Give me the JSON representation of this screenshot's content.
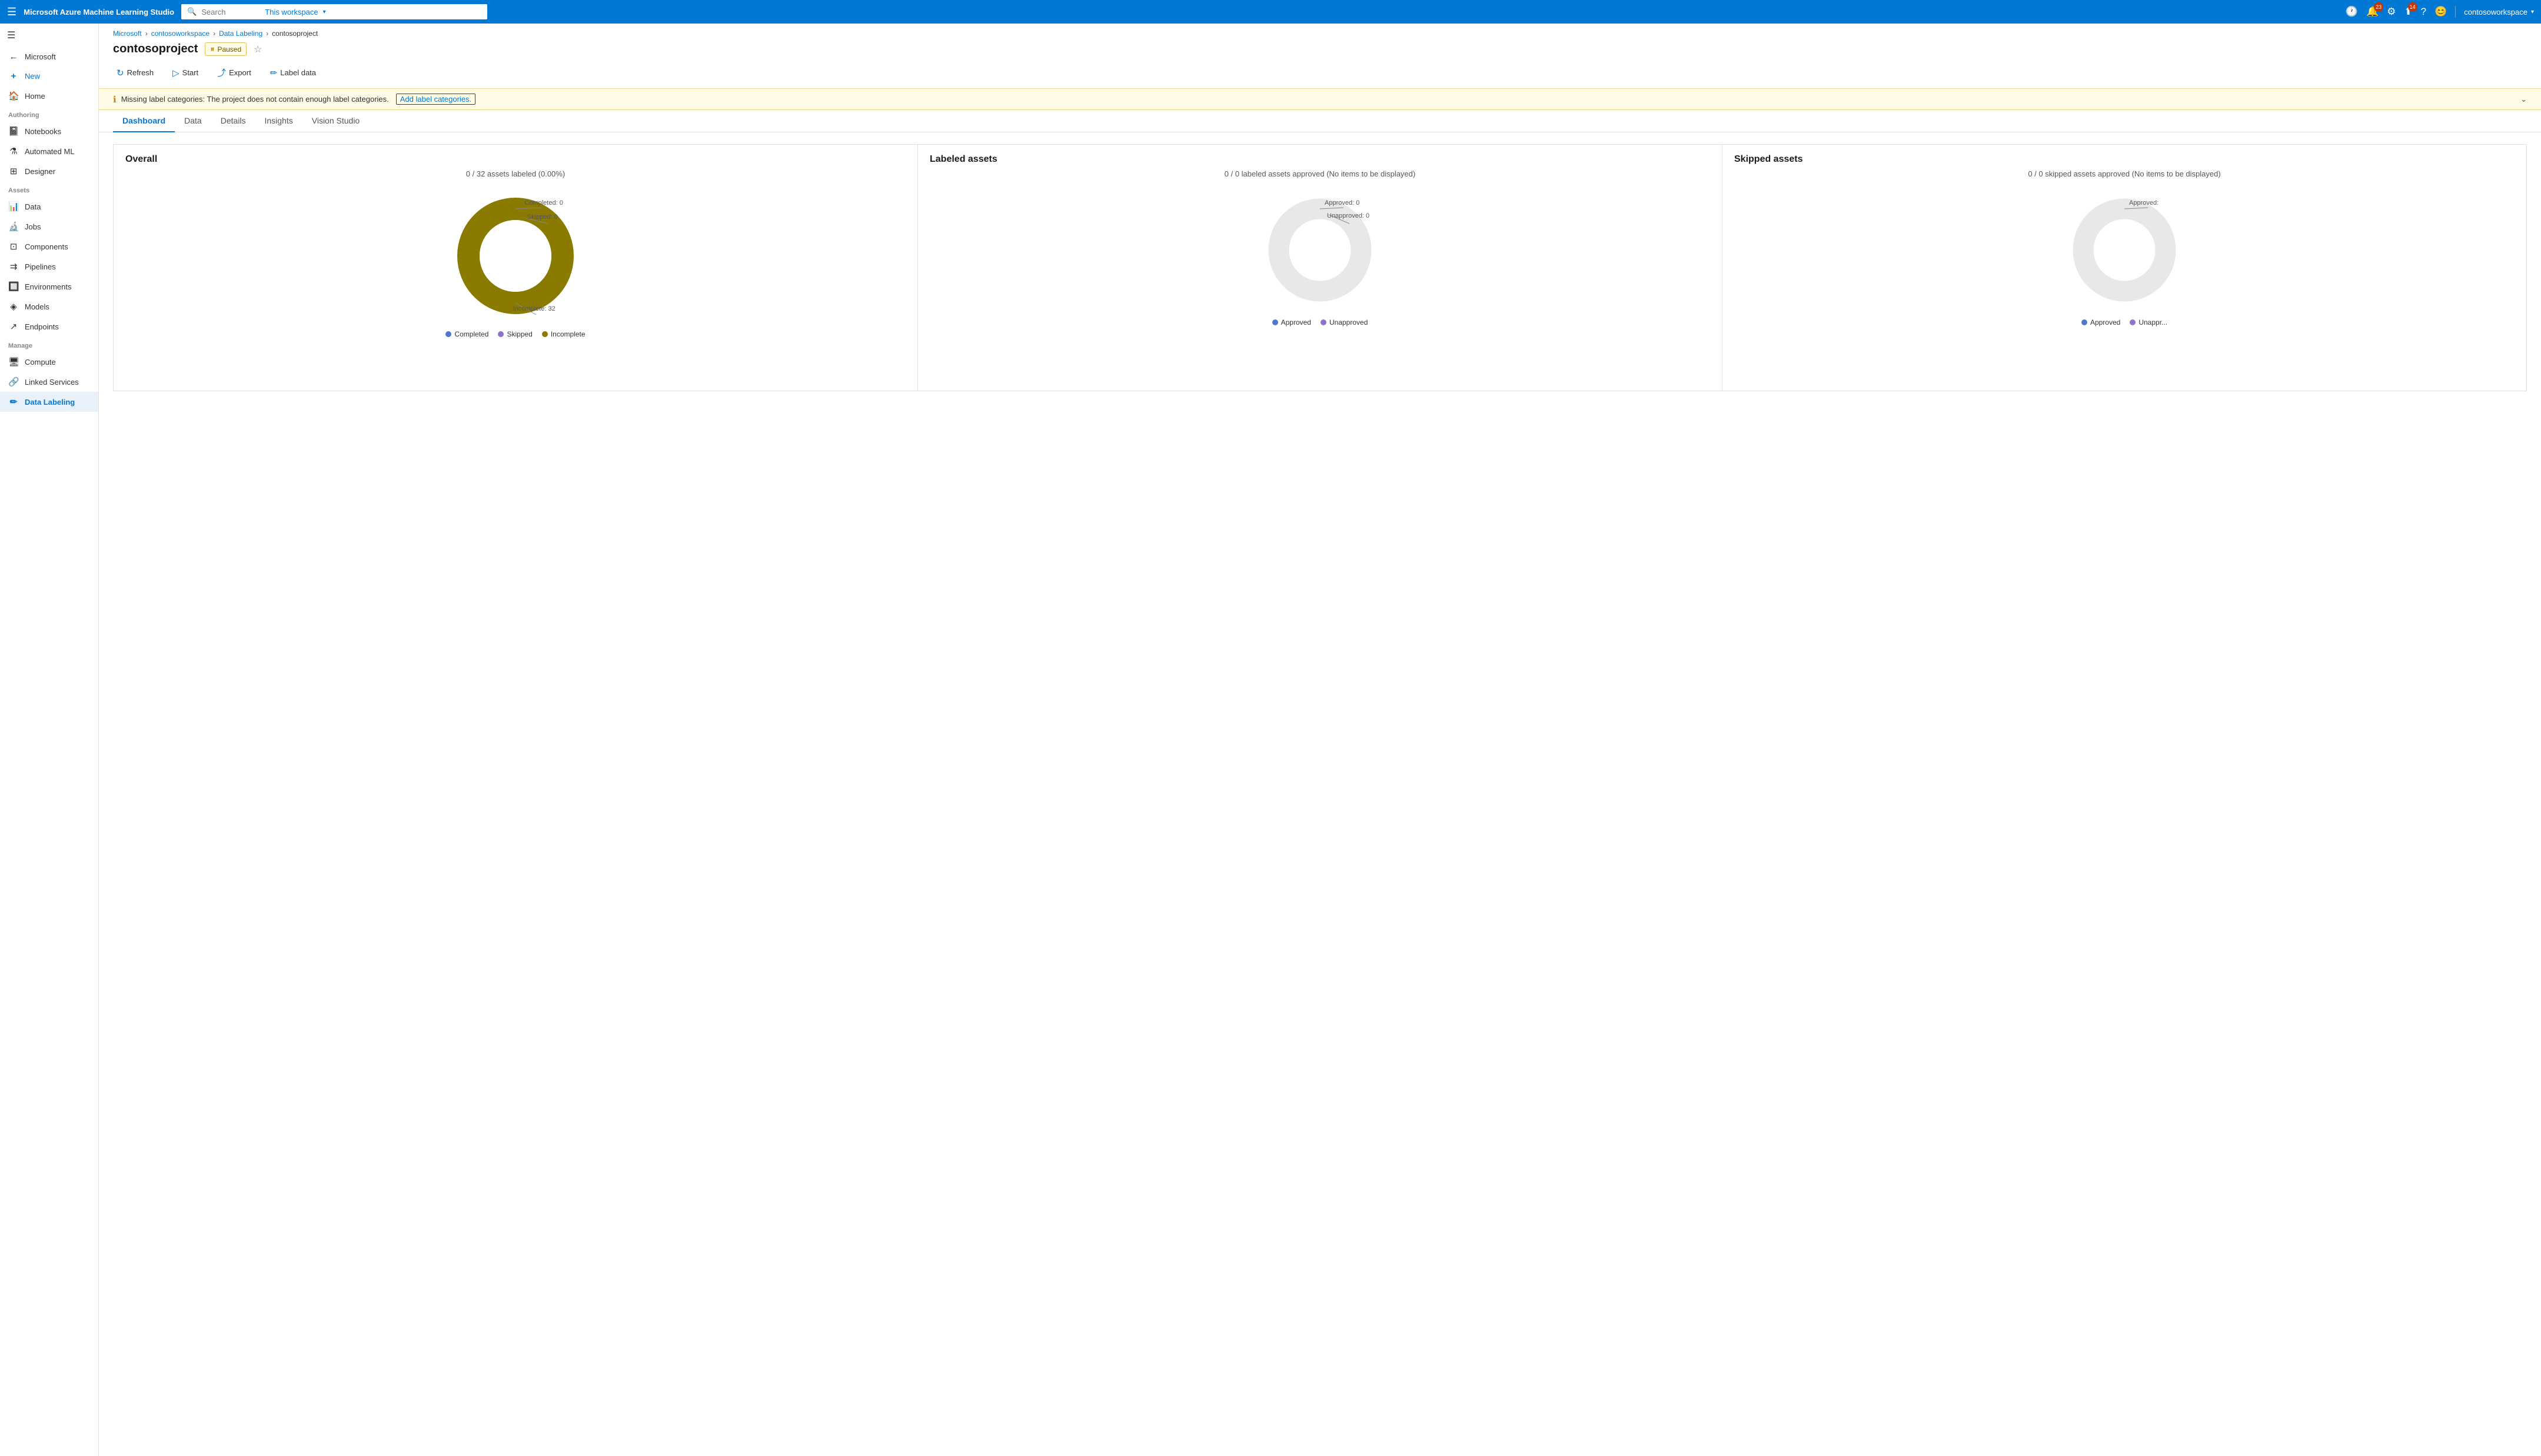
{
  "app": {
    "title": "Microsoft Azure Machine Learning Studio"
  },
  "topnav": {
    "search_placeholder": "Search",
    "search_scope": "This workspace",
    "notifications_count": "23",
    "updates_count": "14",
    "username": "contosoworkspace"
  },
  "sidebar": {
    "microsoft_label": "Microsoft",
    "new_label": "New",
    "home_label": "Home",
    "section_authoring": "Authoring",
    "notebooks_label": "Notebooks",
    "automated_ml_label": "Automated ML",
    "designer_label": "Designer",
    "section_assets": "Assets",
    "data_label": "Data",
    "jobs_label": "Jobs",
    "components_label": "Components",
    "pipelines_label": "Pipelines",
    "environments_label": "Environments",
    "models_label": "Models",
    "endpoints_label": "Endpoints",
    "section_manage": "Manage",
    "compute_label": "Compute",
    "linked_services_label": "Linked Services",
    "data_labeling_label": "Data Labeling"
  },
  "breadcrumb": {
    "microsoft": "Microsoft",
    "workspace": "contosoworkspace",
    "data_labeling": "Data Labeling",
    "project": "contosoproject"
  },
  "header": {
    "title": "contosoproject",
    "status": "Paused"
  },
  "toolbar": {
    "refresh": "Refresh",
    "start": "Start",
    "export": "Export",
    "label_data": "Label data"
  },
  "warning": {
    "message": "Missing label categories: The project does not contain enough label categories.",
    "link_text": "Add label categories."
  },
  "tabs": [
    {
      "id": "dashboard",
      "label": "Dashboard",
      "active": true
    },
    {
      "id": "data",
      "label": "Data",
      "active": false
    },
    {
      "id": "details",
      "label": "Details",
      "active": false
    },
    {
      "id": "insights",
      "label": "Insights",
      "active": false
    },
    {
      "id": "vision_studio",
      "label": "Vision Studio",
      "active": false
    }
  ],
  "overall_card": {
    "title": "Overall",
    "subtitle": "0 / 32 assets labeled (0.00%)",
    "completed_label": "Completed: 0",
    "skipped_label": "Skipped: 0",
    "incomplete_label": "Incomplete: 32",
    "completed_value": 0,
    "skipped_value": 0,
    "incomplete_value": 32,
    "total": 32,
    "legend": [
      {
        "label": "Completed",
        "color": "#4f79c8"
      },
      {
        "label": "Skipped",
        "color": "#8b74c9"
      },
      {
        "label": "Incomplete",
        "color": "#8b7a00"
      }
    ]
  },
  "labeled_assets_card": {
    "title": "Labeled assets",
    "subtitle": "0 / 0 labeled assets approved (No items to be displayed)",
    "approved_label": "Approved: 0",
    "unapproved_label": "Unapproved: 0",
    "legend": [
      {
        "label": "Approved",
        "color": "#4f79c8"
      },
      {
        "label": "Unapproved",
        "color": "#8b74c9"
      }
    ]
  },
  "skipped_assets_card": {
    "title": "Skipped assets",
    "subtitle": "0 / 0 skipped assets approved (No items to be displayed)",
    "approved_label": "Approved:",
    "legend": [
      {
        "label": "Approved",
        "color": "#4f79c8"
      },
      {
        "label": "Unappr...",
        "color": "#8b74c9"
      }
    ]
  }
}
